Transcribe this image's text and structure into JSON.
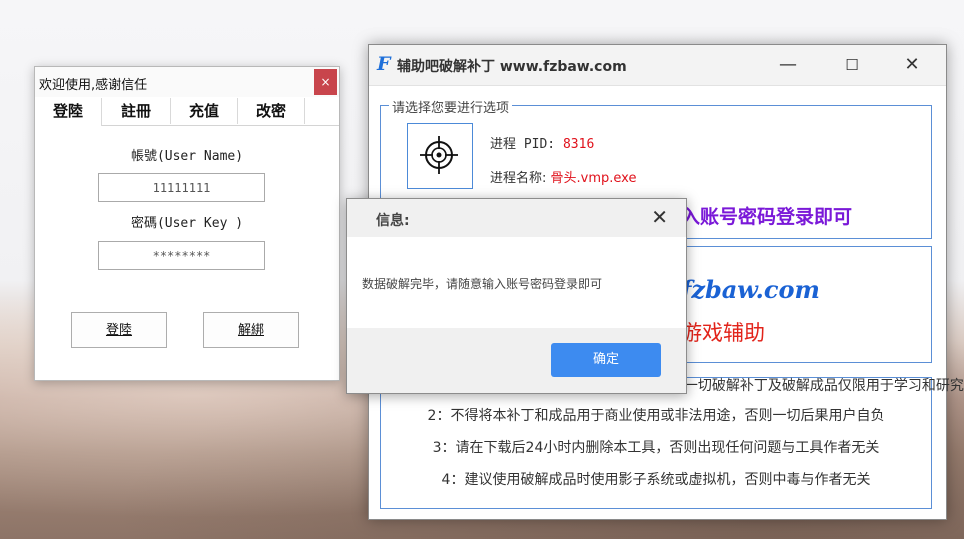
{
  "patch_window": {
    "title": "辅助吧破解补丁 www.fzbaw.com",
    "logo_glyph": "F",
    "minimize_glyph": "—",
    "maximize_glyph": "☐",
    "close_glyph": "✕",
    "select_group_legend": "请选择您要进行选项",
    "pid_label": "进程 PID:",
    "pid_value": "8316",
    "process_name_label": "进程名称:",
    "process_name_value": "骨头.vmp.exe",
    "status_text": "入账号密码登录即可",
    "brand_url": "fzbaw.com",
    "brand_sub": "游戏辅助",
    "notices": [
      "1：破解补丁仅供学习交流，请勿用于商业用途，一切破解补丁及破解成品仅限用于学习和研究",
      "2：不得将本补丁和成品用于商业使用或非法用途，否则一切后果用户自负",
      "3：请在下载后24小时内删除本工具，否则出现任何问题与工具作者无关",
      "4：建议使用破解成品时使用影子系统或虚拟机，否则中毒与作者无关"
    ]
  },
  "login_window": {
    "title": "欢迎使用,感谢信任",
    "close_glyph": "×",
    "tabs": [
      "登陸",
      "註冊",
      "充值",
      "改密"
    ],
    "username_label": "帳號(User Name)",
    "username_value": "11111111",
    "password_label": "密碼(User Key )",
    "password_value": "********",
    "login_button": "登陸",
    "unbind_button": "解綁"
  },
  "message_dialog": {
    "title": "信息:",
    "close_glyph": "✕",
    "message": "数据破解完毕，请随意输入账号密码登录即可",
    "ok_button": "确定"
  },
  "colors": {
    "accent_blue": "#3d8bf0",
    "group_border": "#5b8fd6",
    "red_value": "#e0111b",
    "purple_status": "#7a18d8",
    "close_red": "#c8454c"
  }
}
